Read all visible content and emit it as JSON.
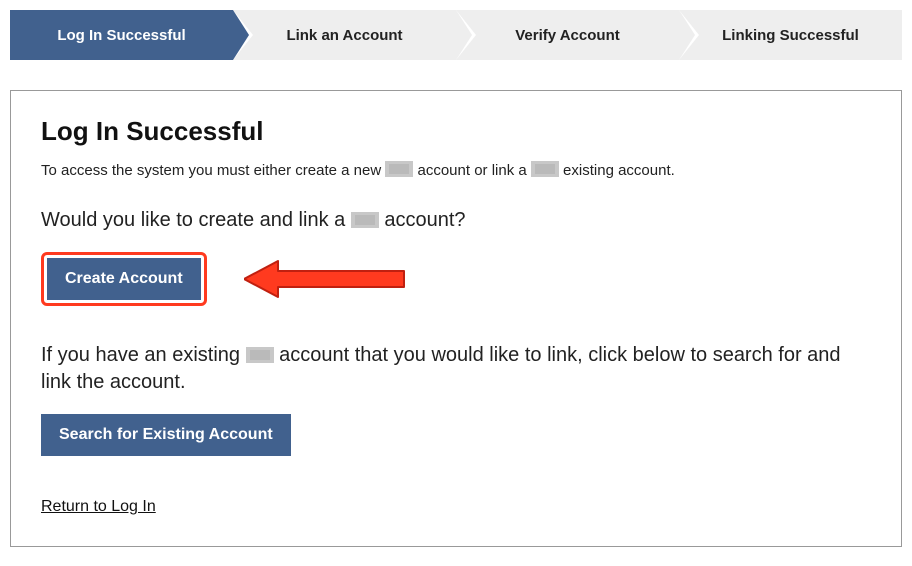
{
  "stepper": {
    "steps": [
      {
        "label": "Log In Successful",
        "active": true
      },
      {
        "label": "Link an Account",
        "active": false
      },
      {
        "label": "Verify Account",
        "active": false
      },
      {
        "label": "Linking Successful",
        "active": false
      }
    ]
  },
  "panel": {
    "heading": "Log In Successful",
    "intro_before": "To access the system you must either create a new ",
    "intro_mid": " account or link a ",
    "intro_after": " existing account.",
    "question_before": "Would you like to create and link a ",
    "question_after": " account?",
    "create_button": "Create Account",
    "existing_before": "If you have an existing ",
    "existing_after": " account that you would like to link, click below to search for and link the account.",
    "search_button": "Search for Existing Account",
    "return_link": "Return to Log In"
  },
  "colors": {
    "primary": "#41618e",
    "highlight": "#ff3a1f"
  }
}
